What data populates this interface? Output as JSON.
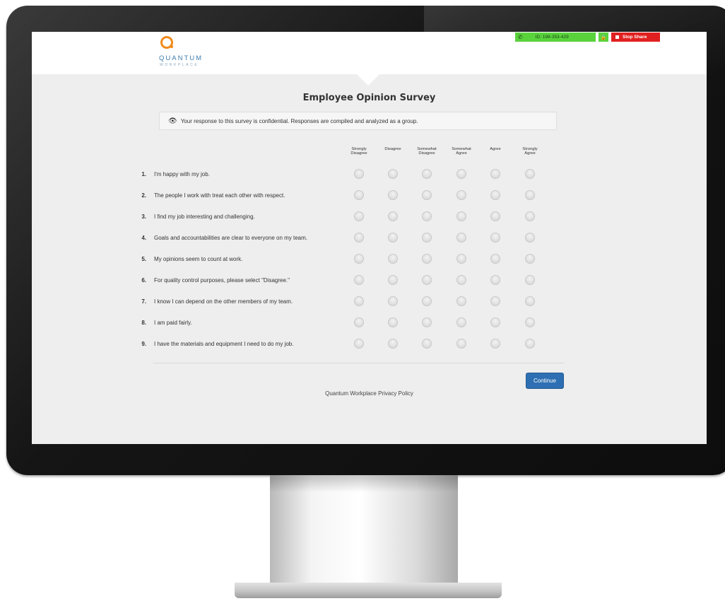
{
  "app": {
    "logo_text": "QUANTUM",
    "logo_subtext": "WORKPLACE",
    "brand_color": "#f08a1c",
    "accent_color": "#2e6fb3"
  },
  "screenshare": {
    "session_id": "ID: 198-353-429",
    "stop_label": "Stop Share",
    "bar_color": "#59d23c",
    "stop_color": "#e02020"
  },
  "survey": {
    "title": "Employee Opinion Survey",
    "notice": "Your response to this survey is confidential. Responses are compiled and analyzed as a group.",
    "scale": [
      "Strongly\nDisagree",
      "Disagree",
      "Somewhat\nDisagree",
      "Somewhat\nAgree",
      "Agree",
      "Strongly\nAgree"
    ],
    "questions": [
      {
        "num": "1.",
        "text": "I'm happy with my job."
      },
      {
        "num": "2.",
        "text": "The people I work with treat each other with respect."
      },
      {
        "num": "3.",
        "text": "I find my job interesting and challenging."
      },
      {
        "num": "4.",
        "text": "Goals and accountabilities are clear to everyone on my team."
      },
      {
        "num": "5.",
        "text": "My opinions seem to count at work."
      },
      {
        "num": "6.",
        "text": "For quality control purposes, please select \"Disagree.\""
      },
      {
        "num": "7.",
        "text": "I know I can depend on the other members of my team."
      },
      {
        "num": "8.",
        "text": "I am paid fairly."
      },
      {
        "num": "9.",
        "text": "I have the materials and equipment I need to do my job."
      }
    ],
    "continue_label": "Continue",
    "privacy_link": "Quantum Workplace Privacy Policy"
  }
}
